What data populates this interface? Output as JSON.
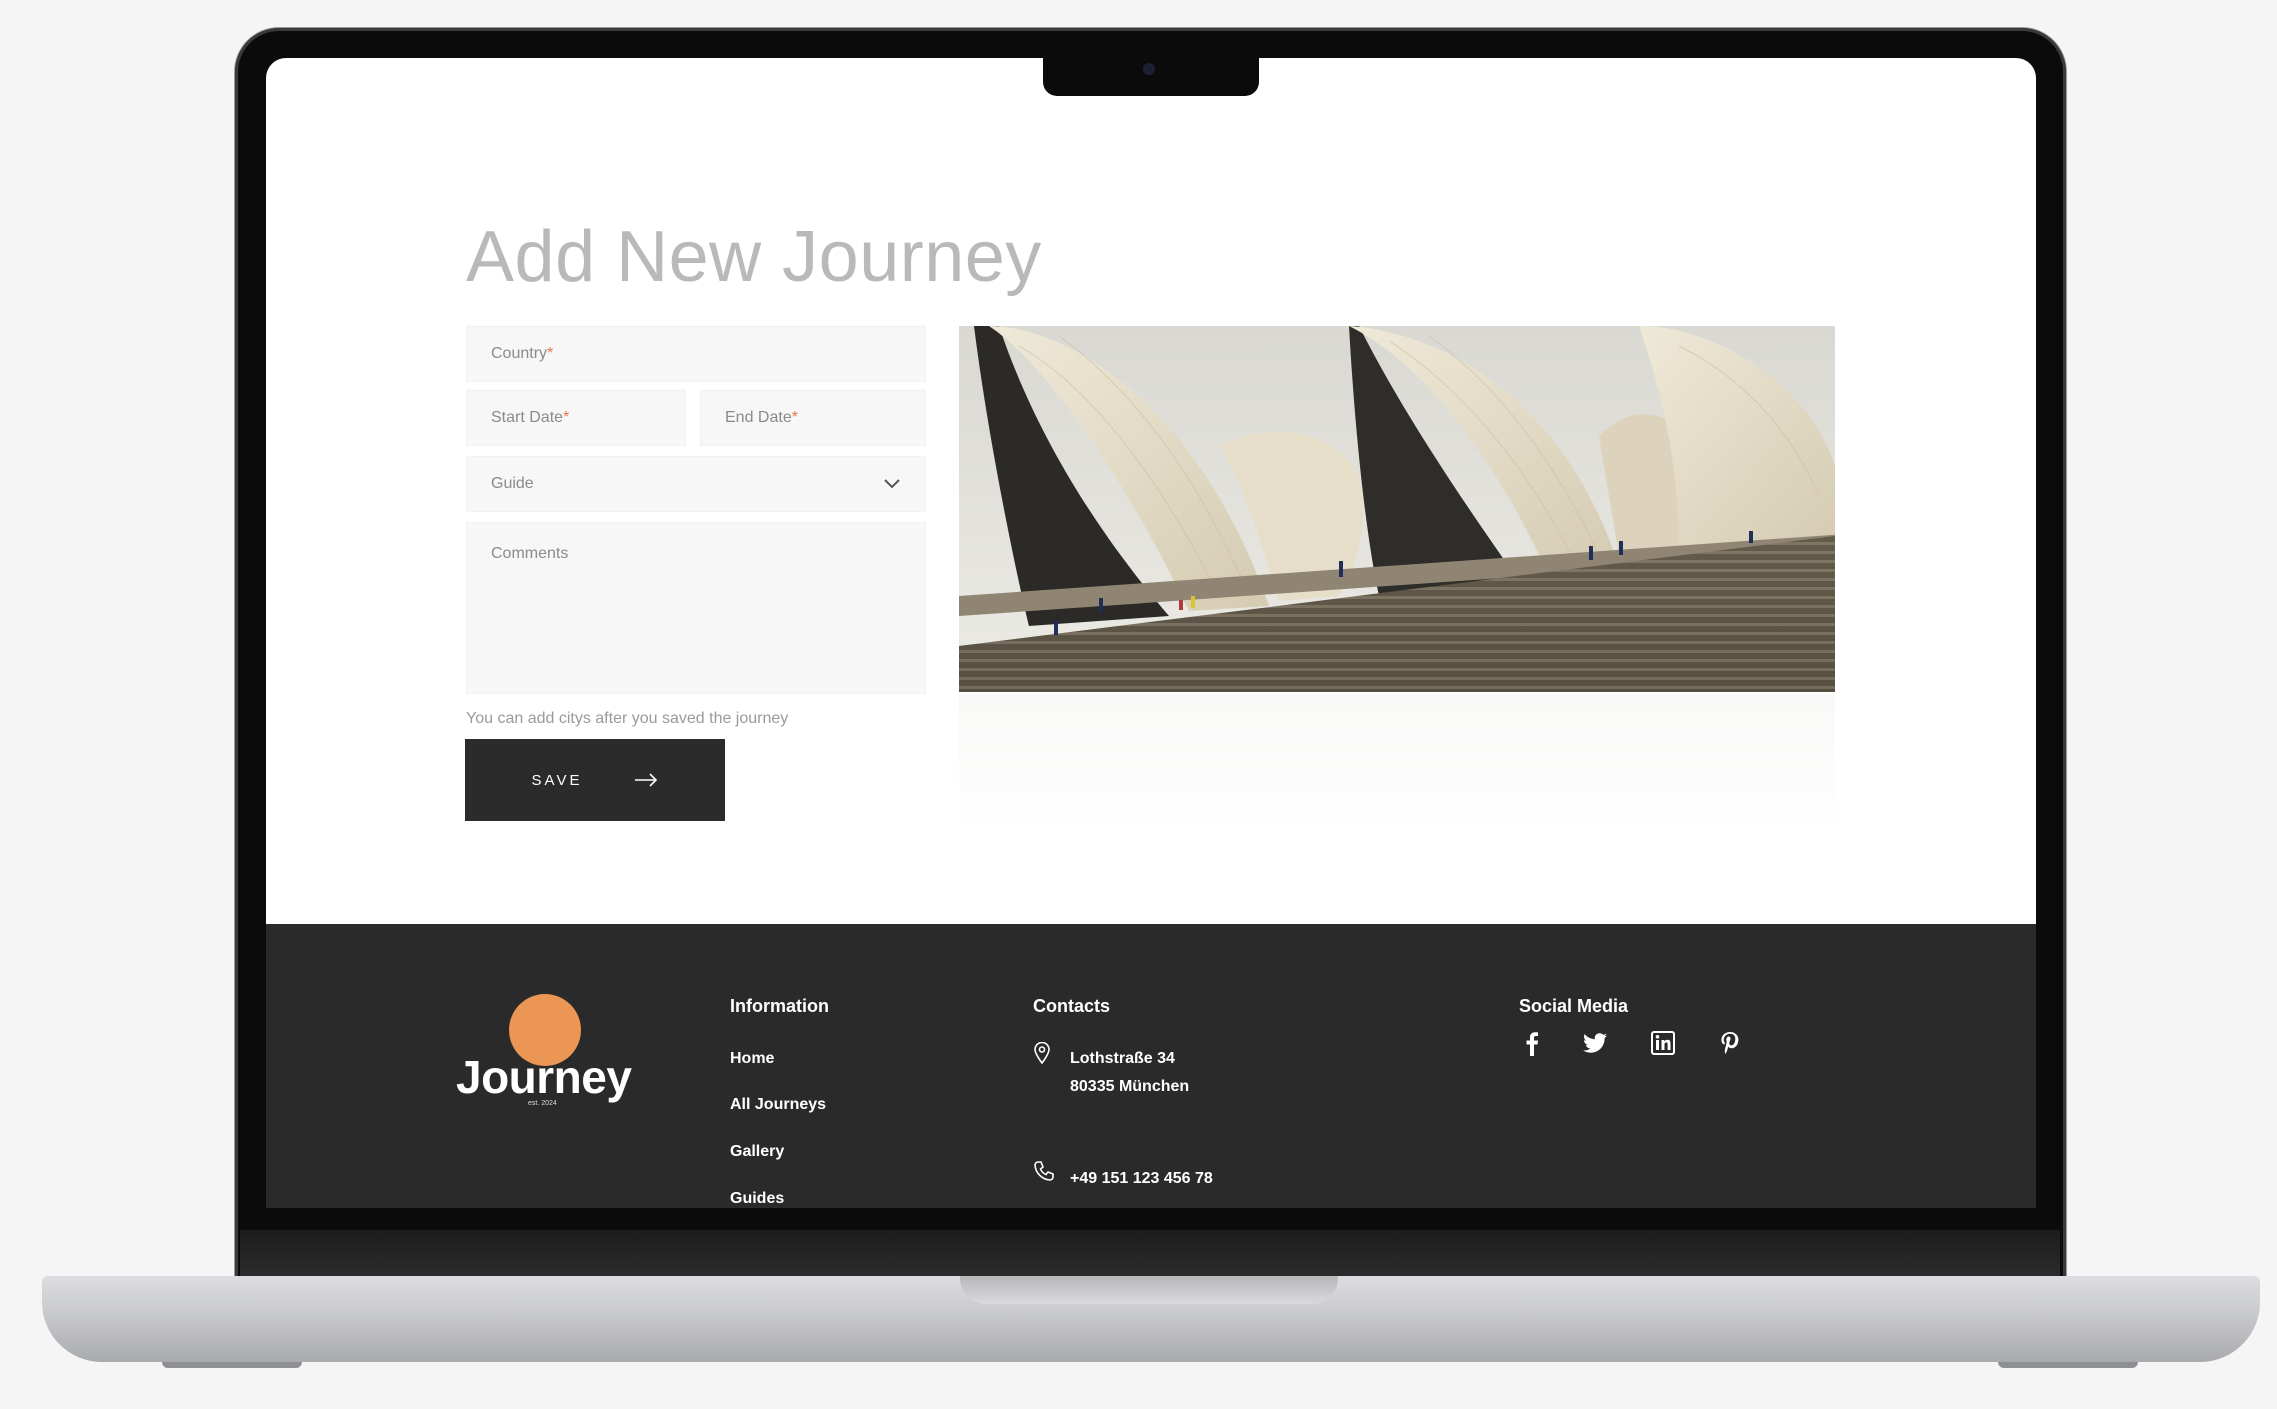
{
  "form": {
    "title": "Add New Journey",
    "country_label": "Country",
    "start_date_label": "Start Date",
    "end_date_label": "End Date",
    "required_mark": "*",
    "guide_label": "Guide",
    "comments_label": "Comments",
    "hint": "You can add citys after you saved the journey",
    "save_label": "SAVE"
  },
  "footer": {
    "logo_text": "Journey",
    "logo_sub": "est. 2024",
    "information_title": "Information",
    "links": [
      "Home",
      "All Journeys",
      "Gallery",
      "Guides"
    ],
    "contacts_title": "Contacts",
    "address_line1": "Lothstraße 34",
    "address_line2": "80335 München",
    "phone": "+49 151 123 456 78",
    "social_title": "Social Media",
    "social_icons": [
      "facebook-icon",
      "twitter-icon",
      "linkedin-icon",
      "pinterest-icon"
    ]
  },
  "colors": {
    "accent": "#ec9655",
    "footer_bg": "#2a2a2a",
    "button_bg": "#2b2b2b",
    "required": "#e07a4a"
  }
}
